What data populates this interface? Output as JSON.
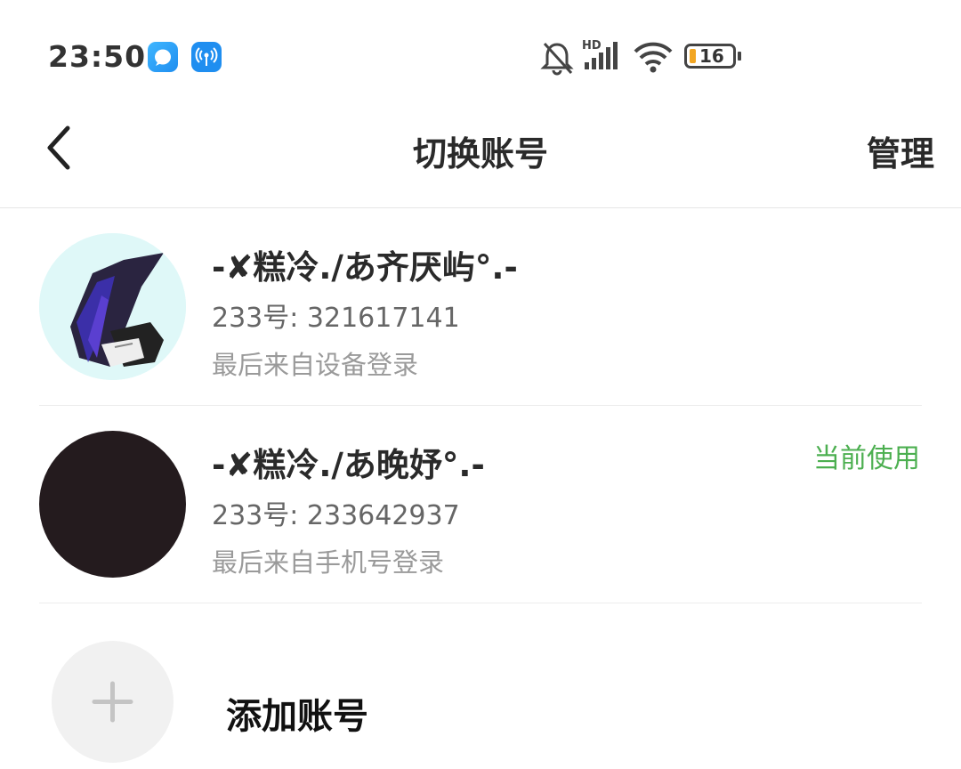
{
  "status_bar": {
    "time": "23:50",
    "network": "HD",
    "battery": "16",
    "icons": [
      "app-icon-bubble",
      "app-icon-wireless",
      "bell-muted-icon",
      "signal-icon",
      "wifi-icon",
      "battery-icon"
    ]
  },
  "header": {
    "title": "切换账号",
    "manage_label": "管理",
    "back_icon": "back-chevron-icon"
  },
  "accounts": [
    {
      "name": "-✘糕冷./あ齐厌屿°.-",
      "id_line": "233号: 321617141",
      "last_login": "最后来自设备登录",
      "current": ""
    },
    {
      "name": "-✘糕冷./あ晚妤°.-",
      "id_line": "233号: 233642937",
      "last_login": "最后来自手机号登录",
      "current": "当前使用"
    }
  ],
  "add_account": {
    "label": "添加账号",
    "icon": "plus-icon"
  },
  "colors": {
    "current_tag": "#4caf50",
    "title_text": "#2a2a2a",
    "secondary_text": "#666666",
    "tertiary_text": "#9a9a9a",
    "divider": "#e6e6e6"
  }
}
